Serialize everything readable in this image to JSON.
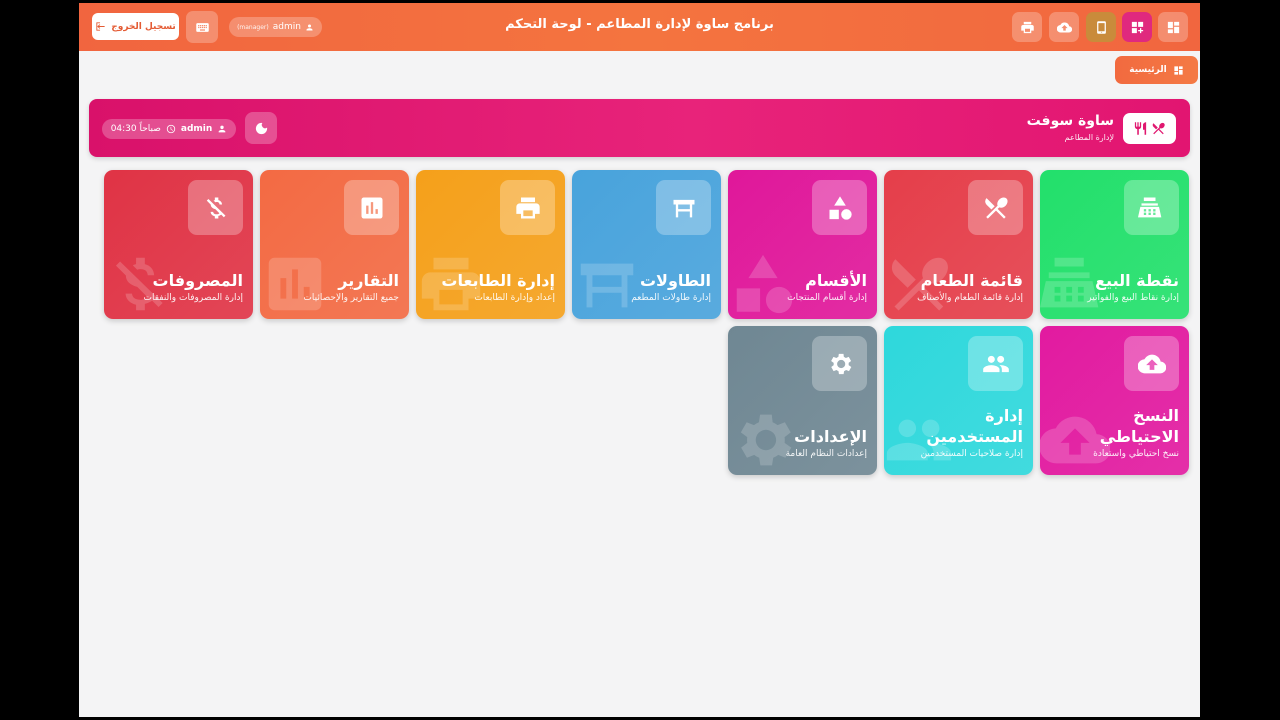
{
  "app": {
    "title": "برنامج ساوة لإدارة المطاعم - لوحة التحكم",
    "logout_label": "تسجيل الخروج",
    "user": "admin",
    "role": "(manager)"
  },
  "breadcrumb": {
    "home_label": "الرئيسية"
  },
  "banner": {
    "brand_name": "ساوة سوفت",
    "brand_sub": "لإدارة المطاعم",
    "user": "admin",
    "time": "04:30 صباحاً"
  },
  "tiles": [
    {
      "title": "نقطة البيع",
      "desc": "إدارة نقاط البيع والفواتير",
      "color": "#22e06b",
      "icon": "cash-register-icon"
    },
    {
      "title": "قائمة الطعام",
      "desc": "إدارة قائمة الطعام والأصناف",
      "color": "#e53e4a",
      "icon": "utensils-icon"
    },
    {
      "title": "الأقسام",
      "desc": "إدارة أقسام المنتجات",
      "color": "#e0179a",
      "icon": "shapes-icon"
    },
    {
      "title": "الطاولات",
      "desc": "إدارة طاولات المطعم",
      "color": "#48a3dc",
      "icon": "table-icon"
    },
    {
      "title": "إدارة الطابعات",
      "desc": "إعداد وإدارة الطابعات",
      "color": "#f5a01a",
      "icon": "printer-icon"
    },
    {
      "title": "التقارير",
      "desc": "جميع التقارير والإحصائيات",
      "color": "#f36a43",
      "icon": "chart-icon"
    },
    {
      "title": "المصروفات",
      "desc": "إدارة المصروفات والنفقات",
      "color": "#e03345",
      "icon": "money-off-icon"
    },
    {
      "title": "النسخ الاحتياطي",
      "desc": "نسخ احتياطي واستعادة",
      "color": "#e21aa0",
      "icon": "cloud-upload-icon"
    },
    {
      "title": "إدارة المستخدمين",
      "desc": "إدارة صلاحيات المستخدمين",
      "color": "#2ed8dc",
      "icon": "users-icon"
    },
    {
      "title": "الإعدادات",
      "desc": "إعدادات النظام العامة",
      "color": "#6f8793",
      "icon": "gear-icon"
    }
  ]
}
